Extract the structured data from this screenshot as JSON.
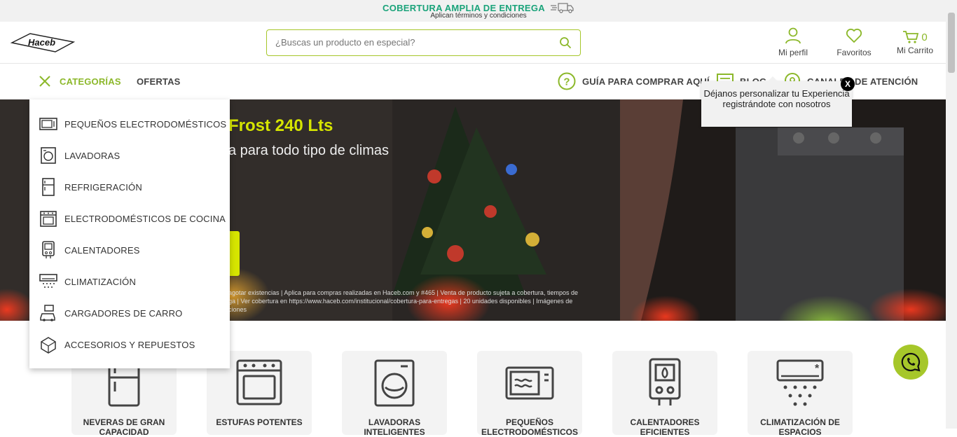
{
  "topbar": {
    "title": "COBERTURA AMPLIA DE ENTREGA",
    "subtitle": "Aplican términos y condiciones"
  },
  "header": {
    "logo_text": "Haceb",
    "search_placeholder": "¿Buscas un producto en especial?",
    "profile_label": "Mi perfil",
    "favorites_label": "Favoritos",
    "cart_label": "Mi Carrito",
    "cart_count": "0"
  },
  "nav": {
    "categories_label": "CATEGORÍAS",
    "offers_label": "OFERTAS",
    "guide_label": "GUÍA PARA COMPRAR AQUÍ",
    "blog_label": "BLOG",
    "support_label": "CANALES DE ATENCIÓN"
  },
  "banner": {
    "headline": "Frost 240 Lts",
    "subline": "a para todo tipo de climas",
    "legal_line1": "agotar existencias | Aplica para compras realizadas en Haceb.com y #465 | Venta de producto sujeta a cobertura, tiempos de",
    "legal_line2": "ga | Ver cobertura en https://www.haceb.com/institucional/cobertura-para-entregas | 20 unidades disponibles | Imágenes de",
    "legal_line3": "ciones"
  },
  "categories": [
    {
      "label": "PEQUEÑOS ELECTRODOMÉSTICOS",
      "icon": "microwave-icon"
    },
    {
      "label": "LAVADORAS",
      "icon": "washer-icon"
    },
    {
      "label": "REFRIGERACIÓN",
      "icon": "fridge-icon"
    },
    {
      "label": "ELECTRODOMÉSTICOS DE COCINA",
      "icon": "stove-icon"
    },
    {
      "label": "CALENTADORES",
      "icon": "heater-icon"
    },
    {
      "label": "CLIMATIZACIÓN",
      "icon": "air-conditioner-icon"
    },
    {
      "label": "CARGADORES DE CARRO",
      "icon": "car-charger-icon"
    },
    {
      "label": "ACCESORIOS Y REPUESTOS",
      "icon": "accessories-icon"
    }
  ],
  "tooltip": {
    "text": "Déjanos personalizar tu Experiencia registrándote con nosotros",
    "close": "X"
  },
  "cards": [
    {
      "label": "NEVERAS DE GRAN CAPACIDAD"
    },
    {
      "label": "ESTUFAS POTENTES"
    },
    {
      "label": "LAVADORAS INTELIGENTES"
    },
    {
      "label": "PEQUEÑOS ELECTRODOMÉSTICOS"
    },
    {
      "label": "CALENTADORES EFICIENTES"
    },
    {
      "label": "CLIMATIZACIÓN DE ESPACIOS"
    }
  ],
  "colors": {
    "accent_green": "#a6c72a",
    "topbar_title": "#1aa37a"
  }
}
